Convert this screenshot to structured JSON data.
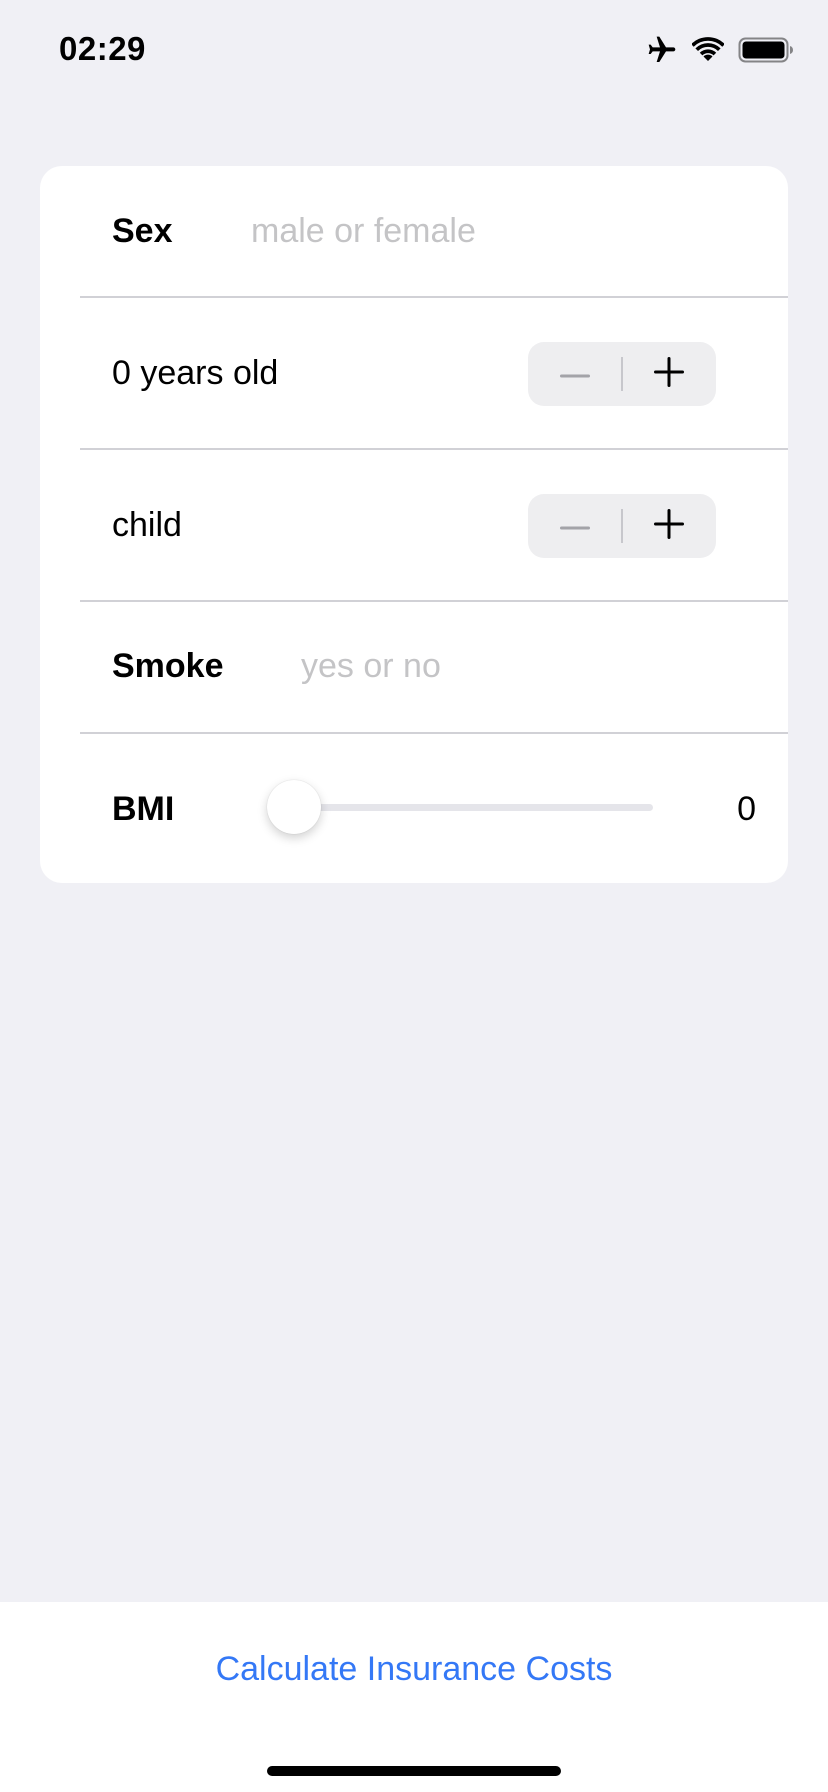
{
  "status_bar": {
    "time": "02:29",
    "icons": [
      "airplane-icon",
      "wifi-icon",
      "battery-icon"
    ]
  },
  "form": {
    "sex": {
      "label": "Sex",
      "value": "",
      "placeholder": "male or female"
    },
    "age": {
      "label": "0 years old",
      "value": 0
    },
    "children": {
      "label": "child",
      "value": 0
    },
    "smoke": {
      "label": "Smoke",
      "value": "",
      "placeholder": "yes or no"
    },
    "bmi": {
      "label": "BMI",
      "value": "0",
      "slider_fraction": 0
    }
  },
  "actions": {
    "calculate_label": "Calculate Insurance Costs"
  },
  "colors": {
    "background": "#f0f0f5",
    "card": "#ffffff",
    "accent": "#3478f6",
    "placeholder": "#c4c4c6",
    "divider": "#d1d1d6"
  }
}
